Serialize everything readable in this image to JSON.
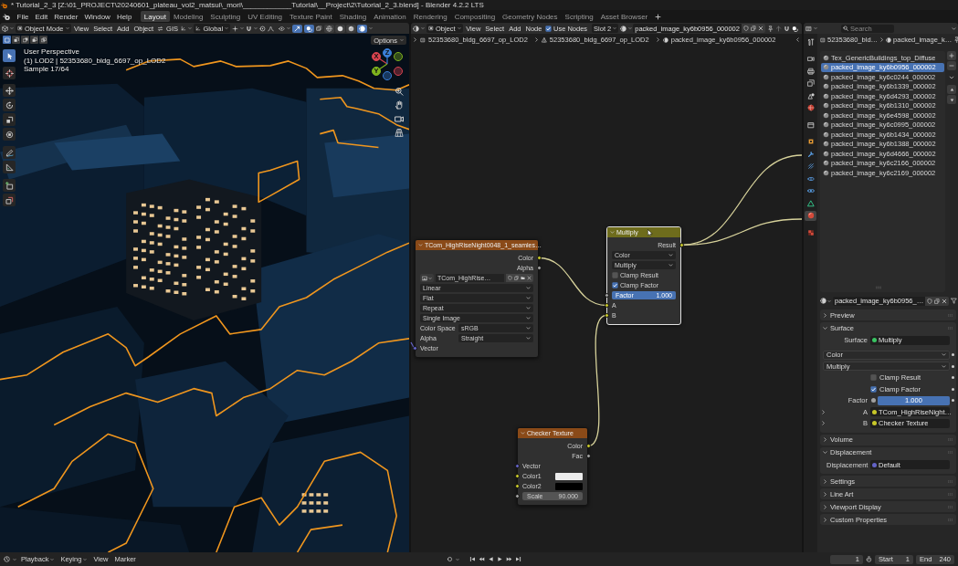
{
  "window": {
    "title": "* Tutorial_2_3 [Z:\\01_PROJECT\\20240601_plateau_vol2_matsui\\_mori\\____________Tutorial\\__Project\\2\\Tutorial_2_3.blend] - Blender 4.2.2 LTS"
  },
  "menus": [
    "File",
    "Edit",
    "Render",
    "Window",
    "Help"
  ],
  "workspaces": [
    {
      "label": "Layout",
      "selected": true
    },
    {
      "label": "Modeling",
      "selected": false
    },
    {
      "label": "Sculpting",
      "selected": false
    },
    {
      "label": "UV Editing",
      "selected": false
    },
    {
      "label": "Texture Paint",
      "selected": false
    },
    {
      "label": "Shading",
      "selected": false
    },
    {
      "label": "Animation",
      "selected": false
    },
    {
      "label": "Rendering",
      "selected": false
    },
    {
      "label": "Compositing",
      "selected": false
    },
    {
      "label": "Geometry Nodes",
      "selected": false
    },
    {
      "label": "Scripting",
      "selected": false
    },
    {
      "label": "Asset Browser",
      "selected": false
    }
  ],
  "viewport": {
    "mode": "Object Mode",
    "menus": [
      "View",
      "Select",
      "Add",
      "Object"
    ],
    "gis": "GIS",
    "orientation": "Global",
    "shading": [
      {
        "kind": "wireframe",
        "selected": false
      },
      {
        "kind": "solid",
        "selected": false
      },
      {
        "kind": "material",
        "selected": false
      },
      {
        "kind": "rendered",
        "selected": true
      }
    ],
    "select_modes": [
      {
        "kind": "set",
        "selected": true
      },
      {
        "kind": "extend",
        "selected": false
      },
      {
        "kind": "subtract",
        "selected": false
      },
      {
        "kind": "invert",
        "selected": false
      },
      {
        "kind": "intersect",
        "selected": false
      }
    ],
    "options": "Options",
    "info": [
      "User Perspective",
      "(1) LOD2 | 52353680_bldg_6697_op_LOD2",
      "Sample 17/64"
    ],
    "tools": [
      {
        "kind": "select",
        "selected": true
      },
      {
        "kind": "cursor",
        "selected": false
      },
      {
        "kind": "move",
        "selected": false
      },
      {
        "kind": "rotate",
        "selected": false
      },
      {
        "kind": "scale",
        "selected": false
      },
      {
        "kind": "transform",
        "selected": false
      },
      {
        "kind": "annotate",
        "selected": false
      },
      {
        "kind": "measure",
        "selected": false
      },
      {
        "kind": "add_cube",
        "selected": false
      },
      {
        "kind": "extrude",
        "selected": false
      }
    ],
    "gizmo": [
      {
        "label": "X",
        "color": "#d8434f"
      },
      {
        "label": "Y",
        "color": "#7fb31d"
      },
      {
        "label": "Z",
        "color": "#3a7fd8"
      }
    ]
  },
  "node_editor": {
    "type": "Object",
    "menus": [
      "View",
      "Select",
      "Add",
      "Node"
    ],
    "use_nodes": {
      "label": "Use Nodes",
      "checked": true
    },
    "slot": "Slot 2",
    "material": "packed_image_ky6b0956_000002",
    "breadcrumbs": [
      {
        "kind": "object",
        "label": "52353680_bldg_6697_op_LOD2"
      },
      {
        "kind": "mesh",
        "label": "52353680_bldg_6697_op_LOD2"
      },
      {
        "kind": "material",
        "label": "packed_image_ky6b0956_000002"
      }
    ],
    "nodes": [
      {
        "kind": "texture",
        "selected": false,
        "title": "TCom_HighRiseNight0048_1_seamles…",
        "rows": [
          {
            "kind": "output",
            "label": "Color",
            "socket": {
              "kind": "color"
            }
          },
          {
            "kind": "output",
            "label": "Alpha",
            "socket": {
              "kind": "float"
            }
          },
          {
            "kind": "image",
            "value": "TCom_HighRise…"
          },
          {
            "kind": "dropdown",
            "value": "Linear"
          },
          {
            "kind": "dropdown",
            "value": "Flat"
          },
          {
            "kind": "dropdown",
            "value": "Repeat"
          },
          {
            "kind": "dropdown",
            "value": "Single Image"
          },
          {
            "kind": "labeled_dropdown",
            "label": "Color Space",
            "value": "sRGB"
          },
          {
            "kind": "labeled_dropdown",
            "label": "Alpha",
            "value": "Straight"
          },
          {
            "kind": "input",
            "label": "Vector",
            "socket": {
              "kind": "vector"
            }
          }
        ]
      },
      {
        "kind": "color",
        "selected": true,
        "title": "Multiply",
        "rows": [
          {
            "kind": "output",
            "label": "Result",
            "socket": {
              "kind": "color"
            }
          },
          {
            "kind": "dropdown",
            "value": "Color"
          },
          {
            "kind": "dropdown",
            "value": "Multiply"
          },
          {
            "kind": "checkbox",
            "label": "Clamp Result",
            "checked": false
          },
          {
            "kind": "checkbox",
            "label": "Clamp Factor",
            "checked": true
          },
          {
            "kind": "slider",
            "label": "Factor",
            "value": "1.000",
            "level": 1,
            "socket": {
              "kind": "float"
            }
          },
          {
            "kind": "input",
            "label": "A",
            "socket": {
              "kind": "color"
            }
          },
          {
            "kind": "input",
            "label": "B",
            "socket": {
              "kind": "color"
            }
          }
        ]
      },
      {
        "kind": "texture",
        "selected": false,
        "title": "Checker Texture",
        "rows": [
          {
            "kind": "output",
            "label": "Color",
            "socket": {
              "kind": "color"
            }
          },
          {
            "kind": "output",
            "label": "Fac",
            "socket": {
              "kind": "float"
            }
          },
          {
            "kind": "input",
            "label": "Vector",
            "socket": {
              "kind": "vector"
            }
          },
          {
            "kind": "color_input",
            "label": "Color1",
            "socket": {
              "kind": "color"
            },
            "color": "#ececec"
          },
          {
            "kind": "color_input",
            "label": "Color2",
            "socket": {
              "kind": "color"
            },
            "color": "#000000"
          },
          {
            "kind": "value_input",
            "label": "Scale",
            "value": "90.000",
            "socket": {
              "kind": "float"
            }
          }
        ]
      }
    ]
  },
  "properties": {
    "search": {
      "placeholder": "Search"
    },
    "breadcrumbs": [
      {
        "kind": "object",
        "label": "52353680_bld…"
      },
      {
        "kind": "material",
        "label": "packed_image_k…"
      }
    ],
    "tabs": [
      {
        "kind": "tool",
        "selected": false
      },
      {
        "kind": "render",
        "selected": false
      },
      {
        "kind": "output",
        "selected": false
      },
      {
        "kind": "view_layer",
        "selected": false
      },
      {
        "kind": "scene",
        "selected": false
      },
      {
        "kind": "world",
        "selected": false
      },
      {
        "kind": "collection",
        "selected": false
      },
      {
        "kind": "object",
        "selected": false
      },
      {
        "kind": "modifiers",
        "selected": false
      },
      {
        "kind": "particles",
        "selected": false
      },
      {
        "kind": "physics",
        "selected": false
      },
      {
        "kind": "constraints",
        "selected": false
      },
      {
        "kind": "data",
        "selected": false
      },
      {
        "kind": "material",
        "selected": true
      },
      {
        "kind": "texture",
        "selected": false
      }
    ],
    "material_slots": [
      {
        "label": "Tex_GenericBuildings_top_Diffuse",
        "selected": false
      },
      {
        "label": "packed_image_ky6b0956_000002",
        "selected": true
      },
      {
        "label": "packed_image_ky6c0244_000002",
        "selected": false
      },
      {
        "label": "packed_image_ky6b1339_000002",
        "selected": false
      },
      {
        "label": "packed_image_ky6d4293_000002",
        "selected": false
      },
      {
        "label": "packed_image_ky6b1310_000002",
        "selected": false
      },
      {
        "label": "packed_image_ky6e4598_000002",
        "selected": false
      },
      {
        "label": "packed_image_ky6c0995_000002",
        "selected": false
      },
      {
        "label": "packed_image_ky6b1434_000002",
        "selected": false
      },
      {
        "label": "packed_image_ky6b1388_000002",
        "selected": false
      },
      {
        "label": "packed_image_ky6d4666_000002",
        "selected": false
      },
      {
        "label": "packed_image_ky6c2166_000002",
        "selected": false
      },
      {
        "label": "packed_image_ky6c2169_000002",
        "selected": false
      }
    ],
    "material": "packed_image_ky6b0956_…",
    "panels": [
      {
        "title": "Preview",
        "expanded": false
      },
      {
        "title": "Surface",
        "expanded": true,
        "rows": [
          {
            "kind": "link",
            "label": "Surface",
            "value": "Multiply",
            "socket": {
              "kind": "shader"
            }
          },
          {
            "kind": "dropdown",
            "value": "Color"
          },
          {
            "kind": "dropdown",
            "value": "Multiply"
          },
          {
            "kind": "checkbox",
            "label": "Clamp Result",
            "checked": false
          },
          {
            "kind": "checkbox",
            "label": "Clamp Factor",
            "checked": true
          },
          {
            "kind": "slider",
            "label": "Factor",
            "value": "1.000",
            "level": 1,
            "socket": {
              "kind": "float"
            }
          },
          {
            "kind": "link",
            "label": "A",
            "value": "TCom_HighRiseNight…",
            "socket": {
              "kind": "color"
            },
            "expanded": false
          },
          {
            "kind": "link",
            "label": "B",
            "value": "Checker Texture",
            "socket": {
              "kind": "color"
            },
            "expanded": false
          }
        ]
      },
      {
        "title": "Volume",
        "expanded": false
      },
      {
        "title": "Displacement",
        "expanded": true,
        "rows": [
          {
            "kind": "link",
            "label": "Displacement",
            "value": "Default",
            "socket": {
              "kind": "vector"
            }
          }
        ]
      },
      {
        "title": "Settings",
        "expanded": false
      },
      {
        "title": "Line Art",
        "expanded": false
      },
      {
        "title": "Viewport Display",
        "expanded": false
      },
      {
        "title": "Custom Properties",
        "expanded": false
      }
    ]
  },
  "timeline": {
    "menus": [
      {
        "label": "Playback",
        "kind": "dropdown"
      },
      {
        "label": "Keying",
        "kind": "dropdown"
      },
      {
        "label": "View",
        "kind": "menu"
      },
      {
        "label": "Marker",
        "kind": "menu"
      }
    ],
    "frame": "1",
    "start": {
      "label": "Start",
      "value": "1"
    },
    "end": {
      "label": "End",
      "value": "240"
    }
  }
}
